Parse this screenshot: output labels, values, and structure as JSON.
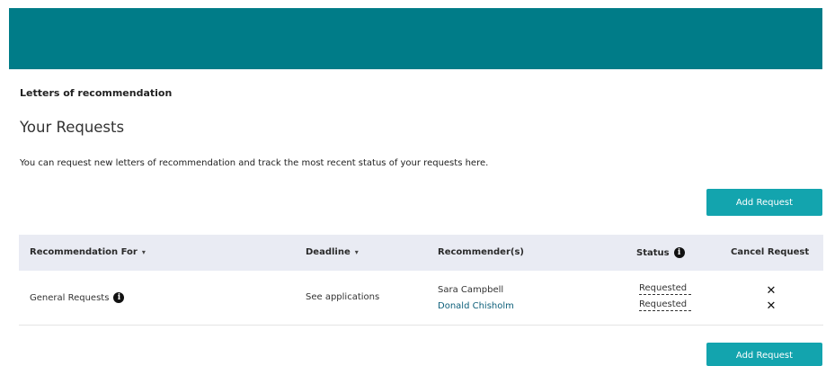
{
  "breadcrumb": "Letters of recommendation",
  "page_title": "Your Requests",
  "intro_text": "You can request new letters of recommendation and track the most recent status of your requests here.",
  "add_request_label": "Add Request",
  "colors": {
    "header": "#007c88",
    "button": "#13a4ae",
    "table_header": "#e9ebf3"
  },
  "table": {
    "headers": {
      "recommendation_for": "Recommendation For",
      "deadline": "Deadline",
      "recommenders": "Recommender(s)",
      "status": "Status",
      "cancel": "Cancel Request"
    },
    "sort_icon": "▾",
    "info_icon": "i",
    "rows": [
      {
        "recommendation_for": "General Requests",
        "deadline": "See applications",
        "recommenders": [
          "Sara Campbell",
          "Donald Chisholm"
        ],
        "statuses": [
          "Requested",
          "Requested"
        ],
        "cancel_icon": "✕"
      }
    ]
  }
}
